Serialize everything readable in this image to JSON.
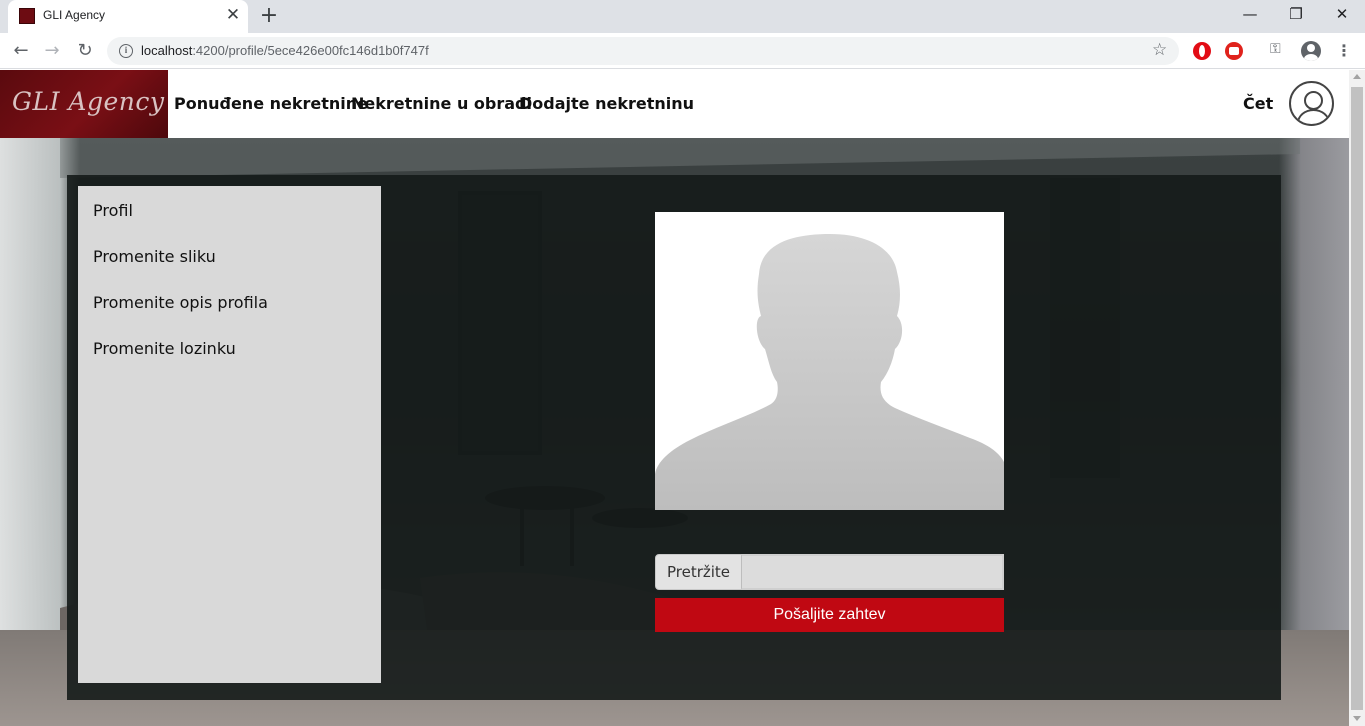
{
  "browser": {
    "tab_title": "GLI Agency",
    "tab_close": "✕",
    "new_tab": "+",
    "url_host": "localhost",
    "url_path": ":4200/profile/5ece426e00fc146d1b0f747f",
    "window_controls": {
      "minimize": "—",
      "maximize": "❐",
      "close": "✕"
    }
  },
  "site": {
    "logo": "GLI Agency",
    "nav": [
      "Ponuđene nekretnine",
      "Nekretnine u obradi",
      "Dodajte nekretninu"
    ],
    "user_name": "Čet"
  },
  "sidebar": {
    "items": [
      "Profil",
      "Promenite sliku",
      "Promenite opis profila",
      "Promenite lozinku"
    ]
  },
  "upload": {
    "browse_label": "Pretržite",
    "file_value": "",
    "submit_label": "Pošaljite zahtev"
  },
  "colors": {
    "brand": "#6d0c12",
    "accent_button": "#c00812",
    "panel": "#151b1a",
    "sidebar_bg": "#d9d9d9"
  },
  "icons": {
    "favicon": "gli-agency-favicon",
    "user": "user-avatar-icon",
    "photo": "default-person-silhouette"
  }
}
